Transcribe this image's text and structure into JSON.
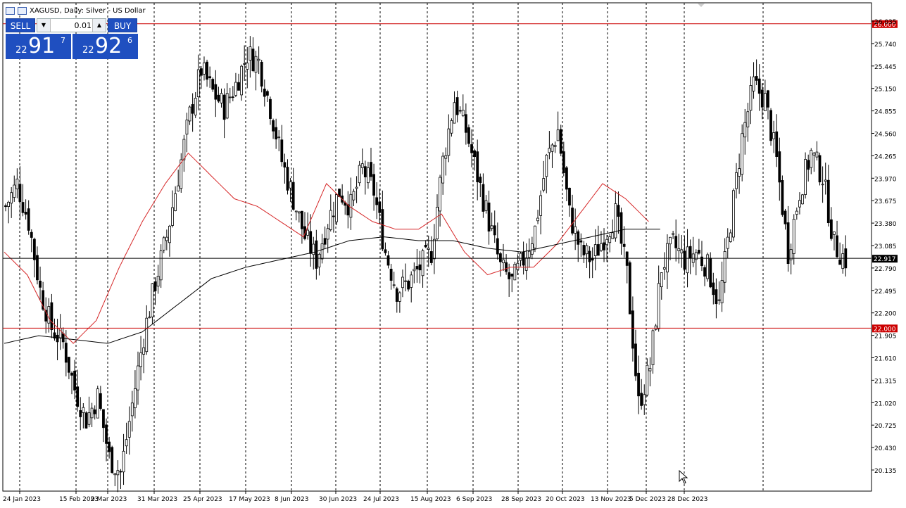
{
  "header": {
    "symbol_text": "XAGUSD, Daily:  Silver - US Dollar"
  },
  "trade_panel": {
    "sell_label": "SELL",
    "buy_label": "BUY",
    "volume": "0.01",
    "sell_price": {
      "prefix": "22",
      "big": "91",
      "sup": "7"
    },
    "buy_price": {
      "prefix": "22",
      "big": "92",
      "sup": "6"
    }
  },
  "colors": {
    "candle": "#000000",
    "ma_fast": "#d62728",
    "ma_slow": "#000000",
    "level_line": "#cc0000",
    "price_line": "#000000",
    "grid": "#000000",
    "accent_blue": "#1f4fc0"
  },
  "chart_data": {
    "type": "candlestick",
    "symbol": "XAGUSD",
    "timeframe": "Daily",
    "ylim": [
      19.9,
      26.3
    ],
    "y_ticks": [
      "26.035",
      "25.740",
      "25.445",
      "25.150",
      "24.855",
      "24.560",
      "24.265",
      "23.970",
      "23.675",
      "23.380",
      "23.085",
      "22.790",
      "22.495",
      "22.200",
      "21.905",
      "21.610",
      "21.315",
      "21.020",
      "20.725",
      "20.430",
      "20.135"
    ],
    "x_ticks": [
      "24 Jan 2023",
      "15 Feb 2023",
      "9 Mar 2023",
      "31 Mar 2023",
      "25 Apr 2023",
      "17 May 2023",
      "8 Jun 2023",
      "30 Jun 2023",
      "24 Jul 2023",
      "15 Aug 2023",
      "6 Sep 2023",
      "28 Sep 2023",
      "20 Oct 2023",
      "13 Nov 2023",
      "5 Dec 2023",
      "28 Dec 2023"
    ],
    "grid": "vertical dashed",
    "horizontal_levels": [
      {
        "value": 26.0,
        "label": "26.000"
      },
      {
        "value": 22.0,
        "label": "22.000"
      }
    ],
    "current_price": {
      "value": 22.917,
      "label": "22.917"
    },
    "series": [
      {
        "type": "candles",
        "close_path": [
          [
            0,
            23.6
          ],
          [
            4,
            23.9
          ],
          [
            8,
            23.4
          ],
          [
            12,
            22.5
          ],
          [
            16,
            22.0
          ],
          [
            20,
            21.8
          ],
          [
            24,
            21.2
          ],
          [
            28,
            20.8
          ],
          [
            32,
            21.1
          ],
          [
            36,
            20.3
          ],
          [
            40,
            20.1
          ],
          [
            44,
            21.0
          ],
          [
            48,
            21.9
          ],
          [
            52,
            22.6
          ],
          [
            56,
            23.2
          ],
          [
            60,
            24.0
          ],
          [
            64,
            24.8
          ],
          [
            68,
            25.4
          ],
          [
            72,
            25.1
          ],
          [
            76,
            24.9
          ],
          [
            80,
            25.2
          ],
          [
            84,
            25.6
          ],
          [
            88,
            25.5
          ],
          [
            92,
            24.9
          ],
          [
            96,
            24.2
          ],
          [
            100,
            23.7
          ],
          [
            104,
            23.2
          ],
          [
            108,
            22.9
          ],
          [
            112,
            23.4
          ],
          [
            116,
            23.8
          ],
          [
            120,
            23.6
          ],
          [
            124,
            24.1
          ],
          [
            128,
            23.8
          ],
          [
            132,
            23.0
          ],
          [
            136,
            22.5
          ],
          [
            140,
            22.6
          ],
          [
            144,
            22.8
          ],
          [
            148,
            23.0
          ],
          [
            152,
            24.2
          ],
          [
            156,
            25.0
          ],
          [
            160,
            24.6
          ],
          [
            164,
            24.0
          ],
          [
            168,
            23.4
          ],
          [
            172,
            22.8
          ],
          [
            176,
            22.6
          ],
          [
            180,
            22.9
          ],
          [
            184,
            23.3
          ],
          [
            188,
            24.2
          ],
          [
            192,
            24.6
          ],
          [
            196,
            23.5
          ],
          [
            200,
            23.0
          ],
          [
            204,
            22.9
          ],
          [
            208,
            23.2
          ],
          [
            212,
            23.5
          ],
          [
            216,
            22.7
          ],
          [
            220,
            21.0
          ],
          [
            224,
            21.5
          ],
          [
            228,
            22.8
          ],
          [
            232,
            23.1
          ],
          [
            236,
            22.9
          ],
          [
            240,
            23.0
          ],
          [
            244,
            22.8
          ],
          [
            248,
            22.3
          ],
          [
            252,
            23.4
          ],
          [
            256,
            24.5
          ],
          [
            260,
            25.2
          ],
          [
            264,
            25.0
          ],
          [
            268,
            24.2
          ],
          [
            272,
            23.0
          ],
          [
            276,
            23.8
          ],
          [
            280,
            24.3
          ],
          [
            284,
            24.0
          ],
          [
            288,
            23.1
          ],
          [
            292,
            22.9
          ]
        ]
      },
      {
        "name": "",
        "type": "ma_fast",
        "values": [
          [
            0,
            23.0
          ],
          [
            8,
            22.7
          ],
          [
            16,
            22.1
          ],
          [
            24,
            21.8
          ],
          [
            32,
            22.1
          ],
          [
            40,
            22.8
          ],
          [
            48,
            23.4
          ],
          [
            56,
            23.9
          ],
          [
            64,
            24.3
          ],
          [
            72,
            24.0
          ],
          [
            80,
            23.7
          ],
          [
            88,
            23.6
          ],
          [
            96,
            23.4
          ],
          [
            104,
            23.2
          ],
          [
            112,
            23.9
          ],
          [
            120,
            23.6
          ],
          [
            128,
            23.4
          ],
          [
            136,
            23.3
          ],
          [
            144,
            23.3
          ],
          [
            152,
            23.5
          ],
          [
            160,
            23.0
          ],
          [
            168,
            22.7
          ],
          [
            176,
            22.8
          ],
          [
            184,
            22.8
          ],
          [
            192,
            23.1
          ],
          [
            200,
            23.5
          ],
          [
            208,
            23.9
          ],
          [
            216,
            23.7
          ],
          [
            224,
            23.4
          ]
        ]
      },
      {
        "name": "",
        "type": "ma_slow",
        "values": [
          [
            0,
            21.8
          ],
          [
            12,
            21.9
          ],
          [
            24,
            21.85
          ],
          [
            36,
            21.8
          ],
          [
            48,
            21.95
          ],
          [
            60,
            22.3
          ],
          [
            72,
            22.65
          ],
          [
            84,
            22.8
          ],
          [
            96,
            22.9
          ],
          [
            108,
            23.0
          ],
          [
            120,
            23.15
          ],
          [
            132,
            23.2
          ],
          [
            144,
            23.15
          ],
          [
            156,
            23.15
          ],
          [
            168,
            23.05
          ],
          [
            180,
            23.0
          ],
          [
            192,
            23.1
          ],
          [
            204,
            23.2
          ],
          [
            216,
            23.3
          ],
          [
            228,
            23.3
          ]
        ]
      }
    ]
  }
}
